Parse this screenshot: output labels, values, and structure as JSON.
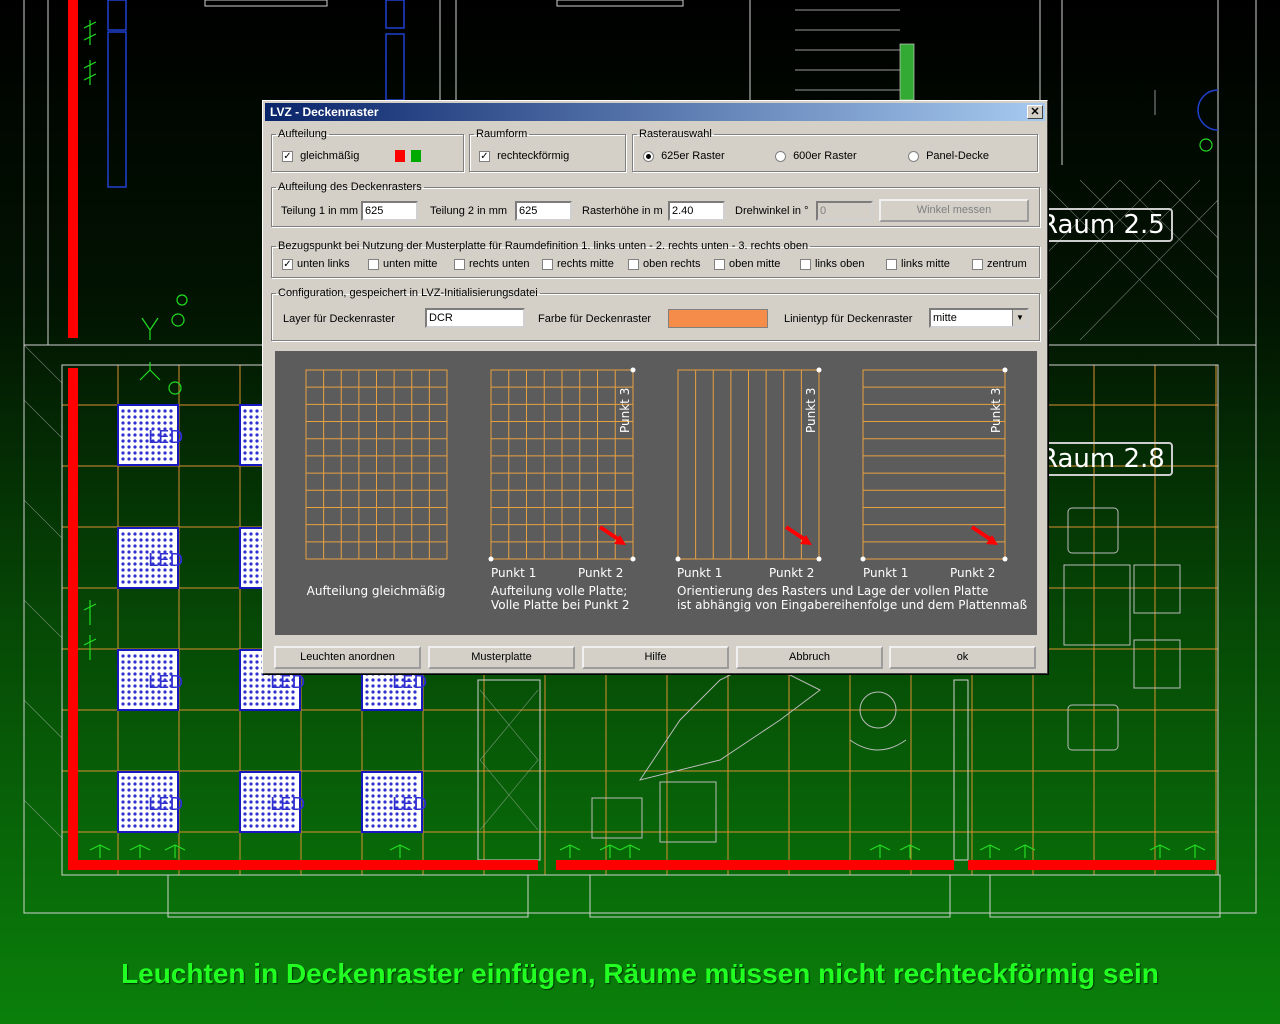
{
  "caption": "Leuchten in Deckenraster einfügen, Räume müssen nicht rechteckförmig sein",
  "rooms": {
    "r25": "Raum 2.5",
    "r28": "Raum 2.8"
  },
  "led_label": "LED",
  "colors": {
    "wall_red": "#ff0000",
    "grid_orange": "#e8a040",
    "led_blue": "#2020c0",
    "caption_green": "#22ff22",
    "swatch_orange": "#f58c4a"
  },
  "dialog": {
    "title": "LVZ - Deckenraster",
    "close_glyph": "✕",
    "aufteilung": {
      "legend": "Aufteilung",
      "gleich_label": "gleichmäßig",
      "gleich_checked": true
    },
    "raumform": {
      "legend": "Raumform",
      "rechteck_label": "rechteckförmig",
      "rechteck_checked": true
    },
    "rasterauswahl": {
      "legend": "Rasterauswahl",
      "options": [
        "625er Raster",
        "600er Raster",
        "Panel-Decke"
      ],
      "selected": "625er Raster"
    },
    "deckenraster": {
      "legend": "Aufteilung des Deckenrasters",
      "teilung1_label": "Teilung 1 in mm",
      "teilung1_value": "625",
      "teilung2_label": "Teilung 2 in mm",
      "teilung2_value": "625",
      "hoehe_label": "Rasterhöhe in m",
      "hoehe_value": "2.40",
      "drehwinkel_label": "Drehwinkel in °",
      "drehwinkel_value": "0",
      "winkel_button": "Winkel messen"
    },
    "bezugspunkt": {
      "legend": "Bezugspunkt bei Nutzung der Musterplatte für Raumdefinition 1. links unten - 2. rechts unten - 3. rechts oben",
      "options": [
        "unten links",
        "unten mitte",
        "rechts unten",
        "rechts mitte",
        "oben rechts",
        "oben mitte",
        "links oben",
        "links mitte",
        "zentrum"
      ],
      "checked": "unten links"
    },
    "config": {
      "legend": "Configuration, gespeichert in LVZ-Initialisierungsdatei",
      "layer_label": "Layer für Deckenraster",
      "layer_value": "DCR",
      "farbe_label": "Farbe für Deckenraster",
      "linientyp_label": "Linientyp für Deckenraster",
      "linientyp_value": "mitte"
    },
    "preview": {
      "caption1": "Aufteilung  gleichmäßig",
      "punkt1": "Punkt  1",
      "punkt2": "Punkt  2",
      "punkt3": "Punkt  3",
      "caption2_l1": "Aufteilung  volle  Platte;",
      "caption2_l2": "Volle  Platte  bei  Punkt  2",
      "caption3_l1": "Orientierung  des  Rasters  und  Lage  der  vollen  Platte",
      "caption3_l2": "ist  abhängig  von  Eingabereihenfolge  und  dem  Plattenmaß"
    },
    "buttons": {
      "leuchten": "Leuchten anordnen",
      "muster": "Musterplatte",
      "hilfe": "Hilfe",
      "abbruch": "Abbruch",
      "ok": "ok"
    }
  }
}
